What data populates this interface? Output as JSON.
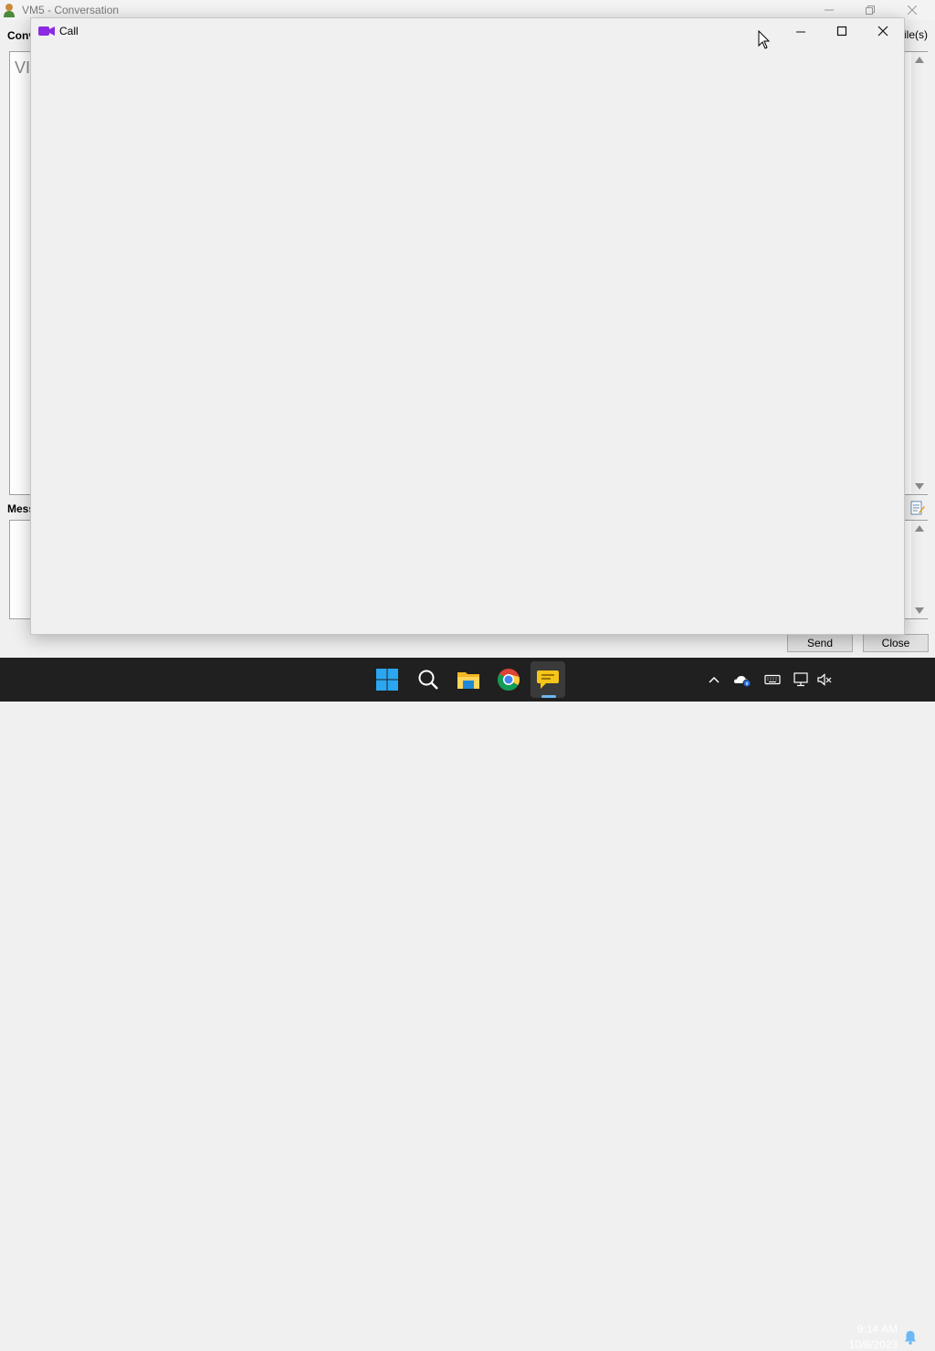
{
  "background_window": {
    "title": "VM5 - Conversation",
    "conversation_label": "Conv",
    "files_label": "ile(s)",
    "history_text": "VI",
    "message_label": "Mess",
    "send_label": "Send",
    "close_label": "Close",
    "icons": [
      "user-icon",
      "minimize-icon",
      "restore-icon",
      "close-icon",
      "edit-icon"
    ]
  },
  "call_window": {
    "title": "Call",
    "accent_color": "#8a2be2",
    "icons": [
      "video-camera-icon",
      "minimize-icon",
      "maximize-icon",
      "close-icon"
    ]
  },
  "taskbar": {
    "apps": [
      "start-icon",
      "search-icon",
      "file-explorer-icon",
      "chrome-icon",
      "chat-app-icon"
    ],
    "tray": [
      "chevron-up-icon",
      "onedrive-icon",
      "keyboard-icon",
      "network-icon",
      "sound-muted-icon",
      "notification-bell-icon"
    ],
    "time": "9:14 AM",
    "date": "10/8/2023"
  }
}
